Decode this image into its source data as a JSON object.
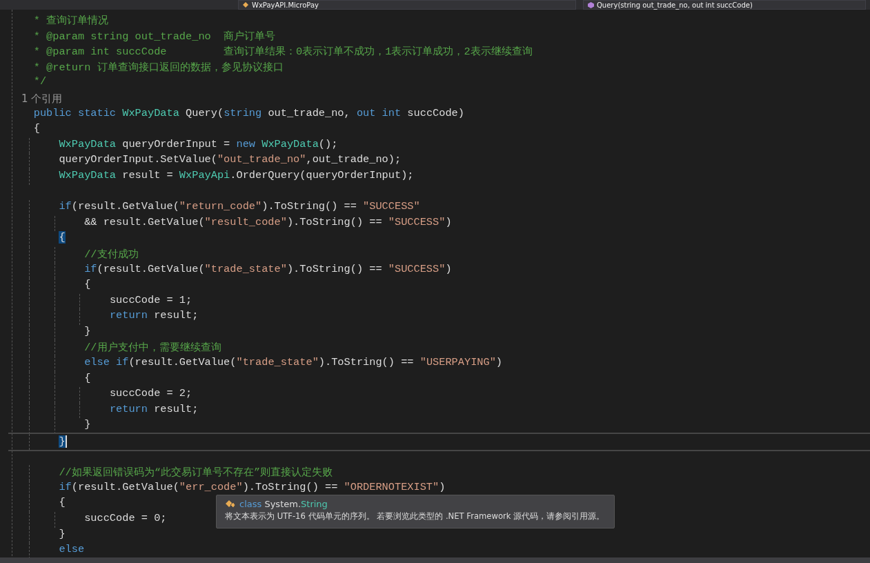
{
  "navigation_bar": {
    "dropdowns": [
      {
        "label": "WxPayAPI.MicroPay",
        "kind": "class"
      },
      {
        "label": "Query(string out_trade_no, out int succCode)",
        "kind": "method"
      }
    ]
  },
  "editor": {
    "lines": [
      {
        "tokens": [
          {
            "kind": "comment",
            "text": "    * 查询订单情况"
          }
        ]
      },
      {
        "tokens": [
          {
            "kind": "comment",
            "text": "    * @param string out_trade_no  商户订单号"
          }
        ]
      },
      {
        "tokens": [
          {
            "kind": "comment",
            "text": "    * @param int succCode         查询订单结果：0表示订单不成功，1表示订单成功，2表示继续查询"
          }
        ]
      },
      {
        "tokens": [
          {
            "kind": "comment",
            "text": "    * @return 订单查询接口返回的数据，参见协议接口"
          }
        ]
      },
      {
        "tokens": [
          {
            "kind": "comment",
            "text": "    */"
          }
        ]
      },
      {
        "kind": "codelens",
        "text": "1 个引用"
      },
      {
        "tokens": [
          {
            "kind": "keyword",
            "text": "    public static "
          },
          {
            "kind": "type",
            "text": "WxPayData"
          },
          {
            "kind": "plain",
            "text": " Query("
          },
          {
            "kind": "keyword",
            "text": "string"
          },
          {
            "kind": "plain",
            "text": " out_trade_no, "
          },
          {
            "kind": "keyword",
            "text": "out int"
          },
          {
            "kind": "plain",
            "text": " succCode)"
          }
        ]
      },
      {
        "tokens": [
          {
            "kind": "plain",
            "text": "    {"
          }
        ]
      },
      {
        "tokens": [
          {
            "kind": "type",
            "text": "        WxPayData"
          },
          {
            "kind": "plain",
            "text": " queryOrderInput = "
          },
          {
            "kind": "keyword",
            "text": "new "
          },
          {
            "kind": "type",
            "text": "WxPayData"
          },
          {
            "kind": "plain",
            "text": "();"
          }
        ]
      },
      {
        "tokens": [
          {
            "kind": "plain",
            "text": "        queryOrderInput.SetValue("
          },
          {
            "kind": "string",
            "text": "\"out_trade_no\""
          },
          {
            "kind": "plain",
            "text": ",out_trade_no);"
          }
        ]
      },
      {
        "tokens": [
          {
            "kind": "type",
            "text": "        WxPayData"
          },
          {
            "kind": "plain",
            "text": " result = "
          },
          {
            "kind": "type",
            "text": "WxPayApi"
          },
          {
            "kind": "plain",
            "text": ".OrderQuery(queryOrderInput);"
          }
        ]
      },
      {
        "kind": "blank"
      },
      {
        "tokens": [
          {
            "kind": "keyword",
            "text": "        if"
          },
          {
            "kind": "plain",
            "text": "(result.GetValue("
          },
          {
            "kind": "string",
            "text": "\"return_code\""
          },
          {
            "kind": "plain",
            "text": ").ToString() == "
          },
          {
            "kind": "string",
            "text": "\"SUCCESS\""
          }
        ]
      },
      {
        "tokens": [
          {
            "kind": "plain",
            "text": "            && result.GetValue("
          },
          {
            "kind": "string",
            "text": "\"result_code\""
          },
          {
            "kind": "plain",
            "text": ").ToString() == "
          },
          {
            "kind": "string",
            "text": "\"SUCCESS\""
          },
          {
            "kind": "plain",
            "text": ")"
          }
        ]
      },
      {
        "tokens": [
          {
            "kind": "plain",
            "text": "        {",
            "highlight": true
          }
        ]
      },
      {
        "tokens": [
          {
            "kind": "comment",
            "text": "            //支付成功"
          }
        ]
      },
      {
        "tokens": [
          {
            "kind": "keyword",
            "text": "            if"
          },
          {
            "kind": "plain",
            "text": "(result.GetValue("
          },
          {
            "kind": "string",
            "text": "\"trade_state\""
          },
          {
            "kind": "plain",
            "text": ").ToString() == "
          },
          {
            "kind": "string",
            "text": "\"SUCCESS\""
          },
          {
            "kind": "plain",
            "text": ")"
          }
        ]
      },
      {
        "tokens": [
          {
            "kind": "plain",
            "text": "            {"
          }
        ]
      },
      {
        "tokens": [
          {
            "kind": "plain",
            "text": "                succCode = 1;"
          }
        ]
      },
      {
        "tokens": [
          {
            "kind": "keyword",
            "text": "                return"
          },
          {
            "kind": "plain",
            "text": " result;"
          }
        ]
      },
      {
        "tokens": [
          {
            "kind": "plain",
            "text": "            }"
          }
        ]
      },
      {
        "tokens": [
          {
            "kind": "comment",
            "text": "            //用户支付中，需要继续查询"
          }
        ]
      },
      {
        "tokens": [
          {
            "kind": "keyword",
            "text": "            else if"
          },
          {
            "kind": "plain",
            "text": "(result.GetValue("
          },
          {
            "kind": "string",
            "text": "\"trade_state\""
          },
          {
            "kind": "plain",
            "text": ").ToString() == "
          },
          {
            "kind": "string",
            "text": "\"USERPAYING\""
          },
          {
            "kind": "plain",
            "text": ")"
          }
        ]
      },
      {
        "tokens": [
          {
            "kind": "plain",
            "text": "            {"
          }
        ]
      },
      {
        "tokens": [
          {
            "kind": "plain",
            "text": "                succCode = 2;"
          }
        ]
      },
      {
        "tokens": [
          {
            "kind": "keyword",
            "text": "                return"
          },
          {
            "kind": "plain",
            "text": " result;"
          }
        ]
      },
      {
        "tokens": [
          {
            "kind": "plain",
            "text": "            }"
          }
        ]
      },
      {
        "current": true,
        "tokens": [
          {
            "kind": "plain",
            "text": "        }",
            "highlight": true
          }
        ]
      },
      {
        "kind": "blank"
      },
      {
        "tokens": [
          {
            "kind": "comment",
            "text": "        //如果返回错误码为“此交易订单号不存在”则直接认定失败"
          }
        ]
      },
      {
        "tokens": [
          {
            "kind": "keyword",
            "text": "        if"
          },
          {
            "kind": "plain",
            "text": "(result.GetValue("
          },
          {
            "kind": "string",
            "text": "\"err_code\""
          },
          {
            "kind": "plain",
            "text": ").ToString() == "
          },
          {
            "kind": "string",
            "text": "\"ORDERNOTEXIST\""
          },
          {
            "kind": "plain",
            "text": ")"
          }
        ]
      },
      {
        "tokens": [
          {
            "kind": "plain",
            "text": "        {"
          }
        ]
      },
      {
        "tokens": [
          {
            "kind": "plain",
            "text": "            succCode = 0;"
          }
        ]
      },
      {
        "tokens": [
          {
            "kind": "plain",
            "text": "        }"
          }
        ]
      },
      {
        "tokens": [
          {
            "kind": "keyword",
            "text": "        else"
          }
        ]
      }
    ]
  },
  "tooltip": {
    "signature": [
      {
        "kind": "keyword",
        "text": "class"
      },
      {
        "kind": "plain",
        "text": "System."
      },
      {
        "kind": "type",
        "text": "String"
      }
    ],
    "description": "将文本表示为 UTF-16 代码单元的序列。 若要浏览此类型的 .NET Framework 源代码，请参阅引用源。"
  }
}
